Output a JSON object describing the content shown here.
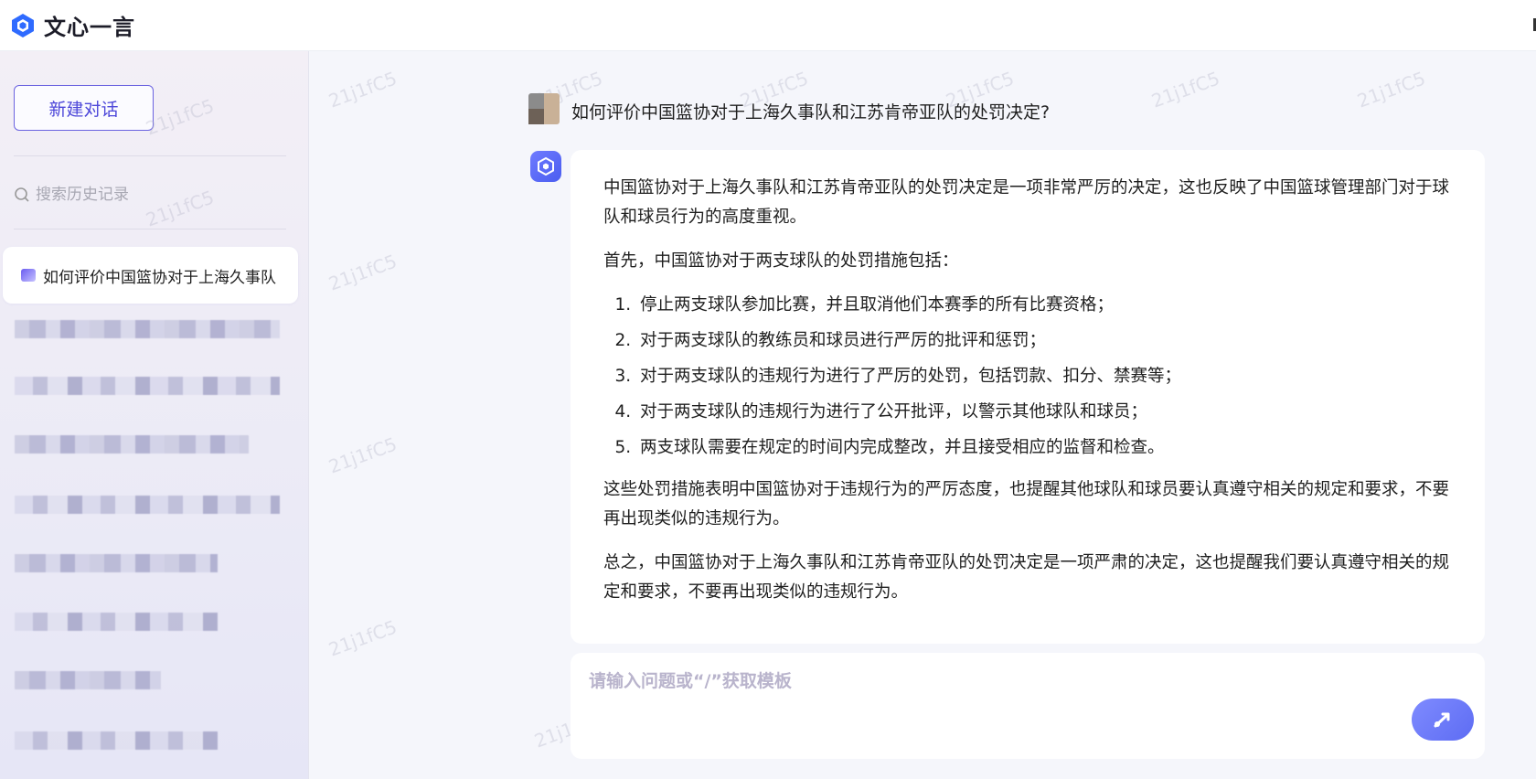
{
  "app": {
    "title": "文心一言",
    "accent": "#4d47d9"
  },
  "sidebar": {
    "new_chat_label": "新建对话",
    "search_placeholder": "搜索历史记录",
    "active_item": "如何评价中国篮协对于上海久事队"
  },
  "conversation": {
    "watermark": "21j1fC5",
    "user_question": "如何评价中国篮协对于上海久事队和江苏肯帝亚队的处罚决定?",
    "answer": {
      "intro": "中国篮协对于上海久事队和江苏肯帝亚队的处罚决定是一项非常严厉的决定，这也反映了中国篮球管理部门对于球队和球员行为的高度重视。",
      "lead": "首先，中国篮协对于两支球队的处罚措施包括：",
      "items": [
        "停止两支球队参加比赛，并且取消他们本赛季的所有比赛资格；",
        "对于两支球队的教练员和球员进行严厉的批评和惩罚；",
        "对于两支球队的违规行为进行了严厉的处罚，包括罚款、扣分、禁赛等；",
        "对于两支球队的违规行为进行了公开批评，以警示其他球队和球员；",
        "两支球队需要在规定的时间内完成整改，并且接受相应的监督和检查。"
      ],
      "p3": "这些处罚措施表明中国篮协对于违规行为的严厉态度，也提醒其他球队和球员要认真遵守相关的规定和要求，不要再出现类似的违规行为。",
      "conclusion": "总之，中国篮协对于上海久事队和江苏肯帝亚队的处罚决定是一项严肃的决定，这也提醒我们要认真遵守相关的规定和要求，不要再出现类似的违规行为。"
    }
  },
  "input": {
    "placeholder": "请输入问题或“/”获取模板"
  }
}
